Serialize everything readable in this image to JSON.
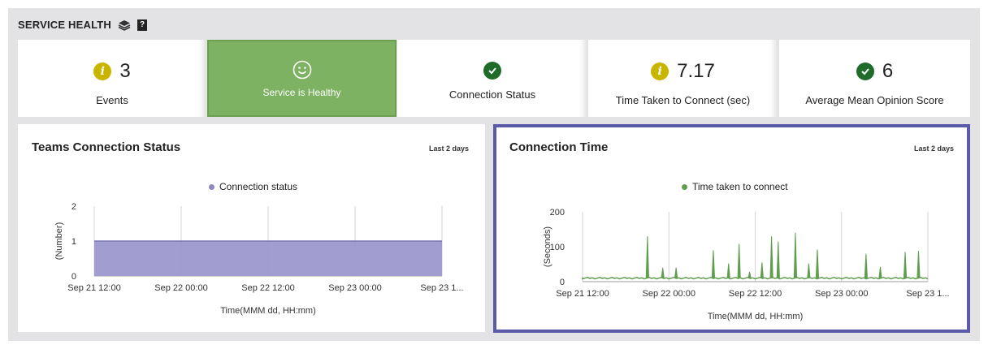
{
  "header": {
    "title": "SERVICE HEALTH",
    "help": "?"
  },
  "tiles": {
    "events": {
      "value": "3",
      "label": "Events"
    },
    "health": {
      "label": "Service is Healthy"
    },
    "connection": {
      "label": "Connection Status"
    },
    "time": {
      "value": "7.17",
      "label": "Time Taken to Connect (sec)"
    },
    "mos": {
      "value": "6",
      "label": "Average Mean Opinion Score"
    }
  },
  "colors": {
    "healthy": "#7cb262",
    "info": "#c9b400",
    "ok": "#1f6b2a",
    "series1": "#9d98cd",
    "series2": "#5f9e4c",
    "selected": "#5b5aa8"
  },
  "cards": {
    "status": {
      "title": "Teams Connection Status",
      "range": "Last 2 days"
    },
    "conn": {
      "title": "Connection Time",
      "range": "Last 2 days"
    }
  },
  "chart_data": [
    {
      "type": "area",
      "legend": "Connection status",
      "xlabel": "Time(MMM dd, HH:mm)",
      "ylabel": "(Number)",
      "yticks": [
        "0",
        "1",
        "2"
      ],
      "ylim": [
        0,
        2
      ],
      "xtick_labels": [
        "Sep 21 12:00",
        "Sep 22 00:00",
        "Sep 22 12:00",
        "Sep 23 00:00",
        "Sep 23 1..."
      ],
      "x": [
        "Sep 21 12:00",
        "Sep 23 ~13:00"
      ],
      "series": [
        {
          "name": "Connection status",
          "values": [
            1,
            1
          ]
        }
      ]
    },
    {
      "type": "line",
      "legend": "Time taken to connect",
      "xlabel": "Time(MMM dd, HH:mm)",
      "ylabel": "(Seconds)",
      "yticks": [
        "0",
        "100",
        "200"
      ],
      "ylim": [
        0,
        200
      ],
      "xtick_labels": [
        "Sep 21 12:00",
        "Sep 22 00:00",
        "Sep 22 12:00",
        "Sep 23 00:00",
        "Sep 23 1..."
      ],
      "x_hours": [
        0,
        3,
        5,
        6,
        6.6,
        7,
        9,
        9.7,
        10,
        10.5,
        10.8,
        12,
        13,
        16,
        17,
        17.5,
        18,
        21,
        21.5,
        22,
        23,
        23.5,
        25,
        27,
        28,
        29,
        29.4,
        30,
        30.5,
        31,
        32.5,
        33,
        33.4,
        34,
        35.7,
        36,
        36.3,
        37,
        38.4,
        39,
        39.3,
        40,
        41,
        42,
        44,
        46,
        47.7,
        48,
        48.4,
        50,
        49.8,
        50.2,
        51,
        53,
        53.4,
        54,
        55.7,
        56,
        56.3,
        57,
        58.6,
        59,
        59.4
      ],
      "values": [
        12,
        11,
        12,
        11,
        118,
        10,
        12,
        11,
        38,
        10,
        11,
        12,
        11,
        11,
        42,
        12,
        11,
        12,
        11,
        12,
        11,
        12,
        11,
        12,
        11,
        12,
        11,
        10,
        12,
        11,
        12,
        11,
        12,
        11,
        10,
        13,
        11,
        12,
        12,
        11,
        12,
        11,
        12,
        11,
        12,
        11,
        12,
        11,
        12,
        11,
        12,
        11,
        12,
        11,
        12,
        11,
        12,
        11,
        12,
        11,
        12,
        11,
        12
      ],
      "peaks": [
        {
          "x": 6.8,
          "y": 130
        },
        {
          "x": 8.4,
          "y": 40
        },
        {
          "x": 9.8,
          "y": 40
        },
        {
          "x": 13.7,
          "y": 90
        },
        {
          "x": 15.3,
          "y": 52
        },
        {
          "x": 16.4,
          "y": 108
        },
        {
          "x": 17.5,
          "y": 28
        },
        {
          "x": 18.8,
          "y": 55
        },
        {
          "x": 19.8,
          "y": 130
        },
        {
          "x": 20.5,
          "y": 115
        },
        {
          "x": 22.3,
          "y": 140
        },
        {
          "x": 23.7,
          "y": 52
        },
        {
          "x": 24.6,
          "y": 92
        },
        {
          "x": 29.7,
          "y": 80
        },
        {
          "x": 31.2,
          "y": 42
        },
        {
          "x": 33.8,
          "y": 85
        },
        {
          "x": 35.2,
          "y": 88
        }
      ]
    }
  ]
}
